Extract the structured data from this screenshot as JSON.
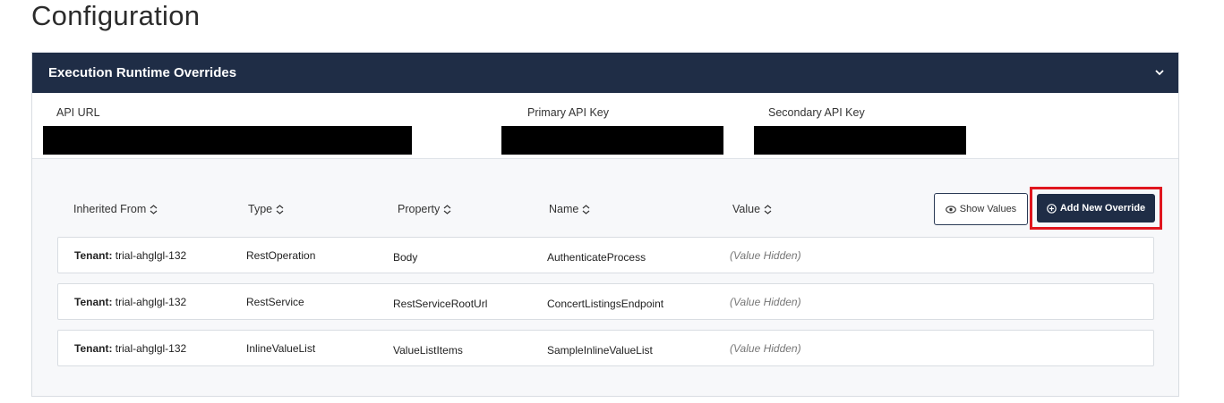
{
  "page": {
    "title": "Configuration"
  },
  "panel": {
    "title": "Execution Runtime Overrides",
    "api_fields": {
      "url_label": "API URL",
      "primary_label": "Primary API Key",
      "secondary_label": "Secondary API Key"
    }
  },
  "table": {
    "columns": {
      "inherited_from": "Inherited From",
      "type": "Type",
      "property": "Property",
      "name": "Name",
      "value": "Value"
    },
    "show_values_label": "Show Values",
    "add_override_label": "Add New Override",
    "rows": [
      {
        "inherited_prefix": "Tenant:",
        "inherited_value": "trial-ahglgl-132",
        "type": "RestOperation",
        "property": "Body",
        "name": "AuthenticateProcess",
        "value": "(Value Hidden)"
      },
      {
        "inherited_prefix": "Tenant:",
        "inherited_value": "trial-ahglgl-132",
        "type": "RestService",
        "property": "RestServiceRootUrl",
        "name": "ConcertListingsEndpoint",
        "value": "(Value Hidden)"
      },
      {
        "inherited_prefix": "Tenant:",
        "inherited_value": "trial-ahglgl-132",
        "type": "InlineValueList",
        "property": "ValueListItems",
        "name": "SampleInlineValueList",
        "value": "(Value Hidden)"
      }
    ]
  },
  "colors": {
    "header_bg": "#1f2d46",
    "highlight": "#e0161e"
  }
}
